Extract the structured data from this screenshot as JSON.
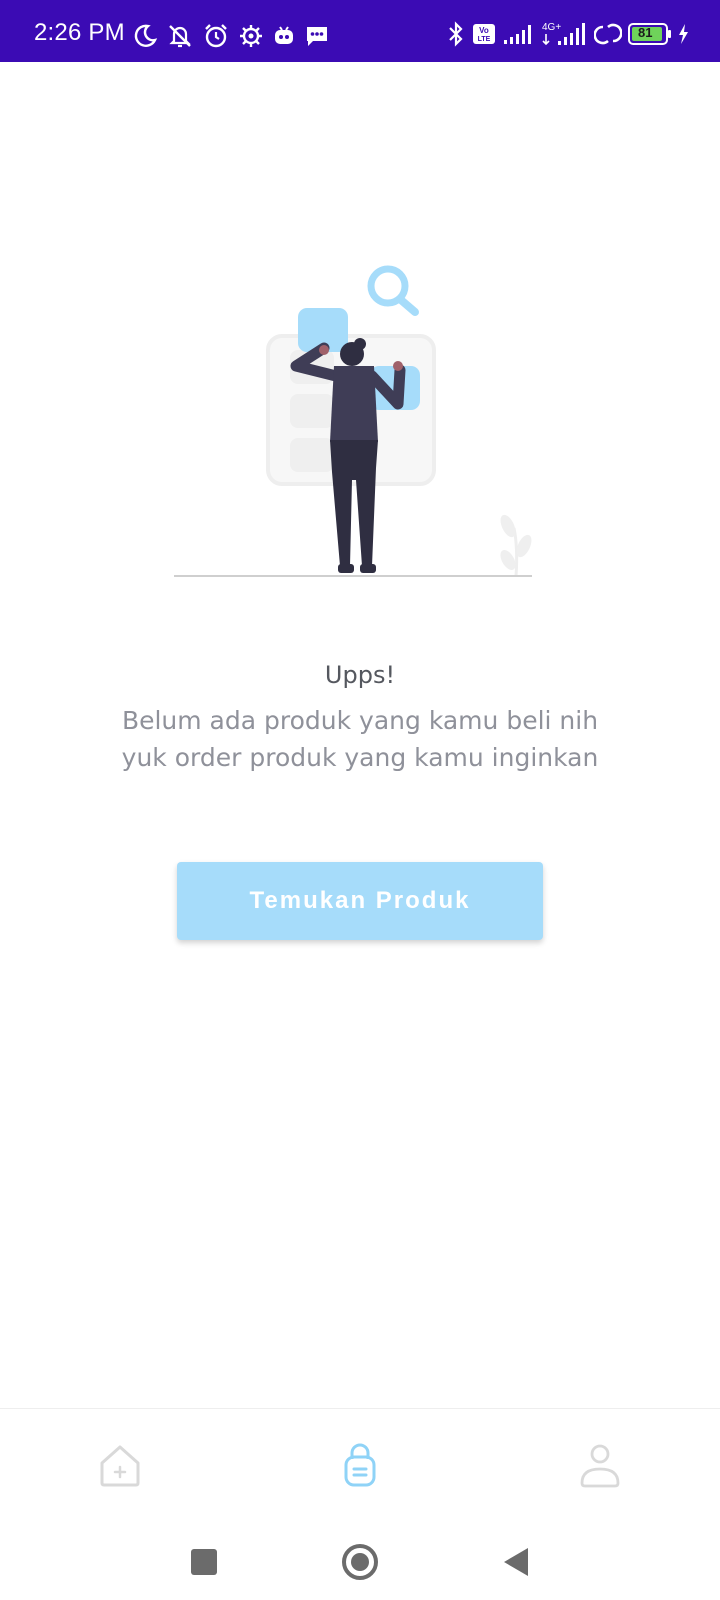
{
  "status_bar": {
    "time": "2:26 PM",
    "battery_level": "81",
    "left_icons": [
      "moon-icon",
      "bell-off-icon",
      "alarm-icon",
      "gear-icon",
      "robot-icon",
      "message-icon"
    ],
    "right_icons": [
      "bluetooth-icon",
      "volte-icon",
      "signal-icon",
      "signal-4g-icon",
      "hotspot-icon",
      "battery-icon",
      "charging-icon"
    ],
    "background": "#3b0bb4"
  },
  "empty_state": {
    "title": "Upps!",
    "message_line1": "Belum ada produk yang kamu beli nih",
    "message_line2": "yuk order produk yang kamu inginkan",
    "button_label": "Temukan Produk",
    "illustration": "woman-browsing-products-illustration"
  },
  "bottom_nav": {
    "items": [
      {
        "id": "home",
        "icon": "home-add-icon",
        "active": false
      },
      {
        "id": "orders",
        "icon": "shopping-bag-icon",
        "active": true
      },
      {
        "id": "profile",
        "icon": "user-icon",
        "active": false
      }
    ]
  },
  "system_nav": {
    "buttons": [
      "recent-apps-icon",
      "home-circle-icon",
      "back-triangle-icon"
    ]
  },
  "colors": {
    "accent": "#a6dcfa",
    "active_icon": "#8fd3f7",
    "inactive_icon": "#d9d9d9",
    "text_primary": "#55585f",
    "text_secondary": "#8f919a"
  }
}
